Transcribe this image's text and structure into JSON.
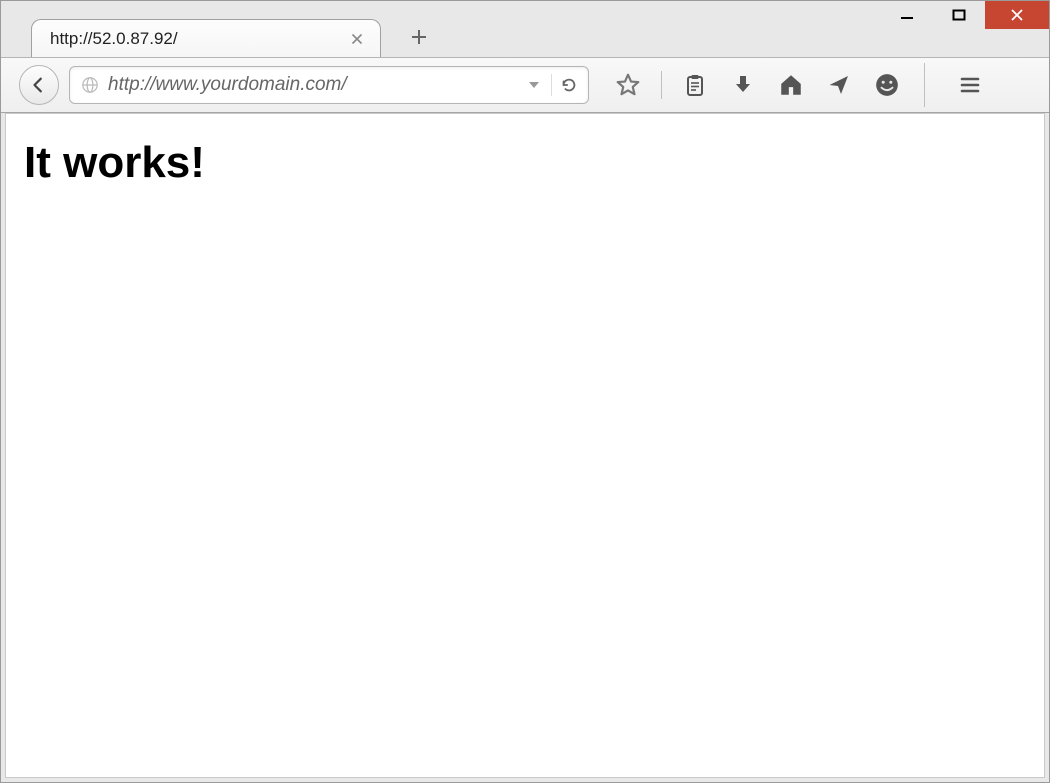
{
  "tab": {
    "title": "http://52.0.87.92/"
  },
  "address_bar": {
    "value": "http://www.yourdomain.com/"
  },
  "page": {
    "heading": "It works!"
  },
  "icons": {
    "globe": "globe-icon",
    "dropdown": "chevron-down-icon",
    "reload": "reload-icon",
    "star": "star-icon",
    "clipboard": "clipboard-icon",
    "download": "download-arrow-icon",
    "home": "home-icon",
    "send": "paper-plane-icon",
    "smile": "smiley-icon",
    "menu": "hamburger-icon",
    "back": "back-arrow-icon",
    "new_tab": "plus-icon",
    "tab_close": "close-icon",
    "win_minimize": "window-minimize-icon",
    "win_maximize": "window-maximize-icon",
    "win_close": "window-close-icon"
  },
  "colors": {
    "close_button": "#c74632",
    "chrome_bg": "#e8e8e8",
    "text": "#000000"
  }
}
